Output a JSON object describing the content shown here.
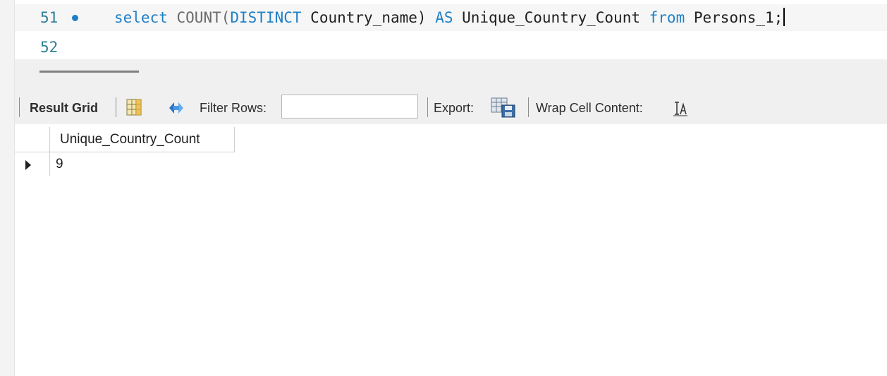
{
  "editor": {
    "lines": [
      {
        "number": "51",
        "tokens": {
          "t1": "select",
          "t2": " ",
          "t3": "COUNT(",
          "t4": "DISTINCT",
          "t5": " Country_name) ",
          "t6": "AS",
          "t7": " Unique_Country_Count ",
          "t8": "from",
          "t9": " Persons_1;"
        }
      },
      {
        "number": "52"
      }
    ]
  },
  "toolbar": {
    "result_grid_label": "Result Grid",
    "filter_rows_label": "Filter Rows:",
    "filter_value": "",
    "export_label": "Export:",
    "wrap_label": "Wrap Cell Content:"
  },
  "result": {
    "columns": [
      "Unique_Country_Count"
    ],
    "rows": [
      [
        "9"
      ]
    ]
  },
  "colors": {
    "keyword": "#1f80c4",
    "function": "#6a6a6a",
    "line_number": "#2f7f93",
    "toolbar_bg": "#f0f0f0"
  },
  "icons": {
    "grid": "grid-columns-icon",
    "refresh": "refresh-icon",
    "export": "export-icon",
    "wrap": "wrap-cell-icon"
  }
}
